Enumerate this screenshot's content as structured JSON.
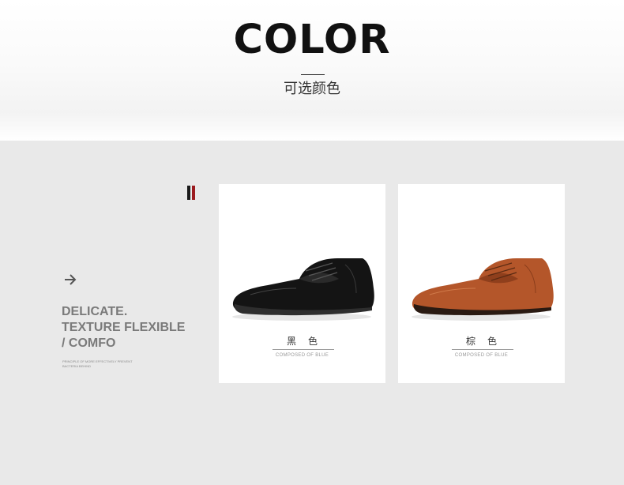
{
  "header": {
    "title": "COLOR",
    "subtitle": "可选颜色"
  },
  "colors": {
    "panel_bg": "#e9e9e9",
    "accent_dark": "#1a1a1a",
    "accent_red": "#9b1b1f",
    "black_leather": "#141414",
    "brown_leather": "#b4562a"
  },
  "side": {
    "arrow_icon": "right-arrow-icon",
    "slogan_lines": [
      "DELICATE.",
      "TEXTURE FLEXIBLE",
      "/ COMFO"
    ],
    "small_lines": [
      "PRINCIPLE OF MORE EFFECTIVELY PREVENT",
      "BACTERIA BEHIND"
    ]
  },
  "cards": [
    {
      "label": "黑色",
      "sub": "COMPOSED OF BLUE",
      "image": "black-oxford-shoe"
    },
    {
      "label": "棕色",
      "sub": "COMPOSED OF BLUE",
      "image": "brown-oxford-shoe"
    }
  ]
}
